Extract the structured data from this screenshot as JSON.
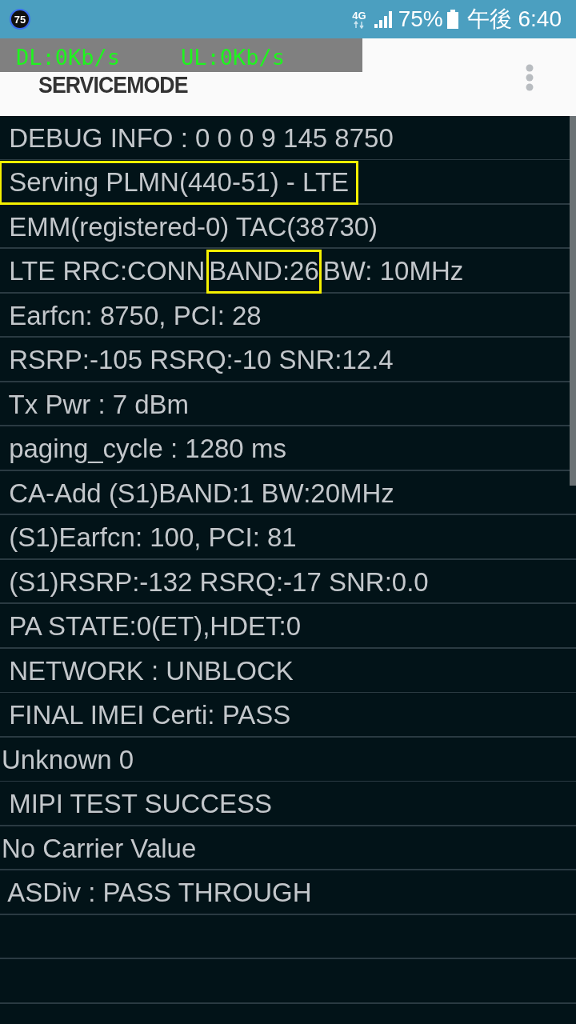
{
  "status_bar": {
    "badge": "75",
    "network": "4G",
    "battery": "75%",
    "time": "午後 6:40"
  },
  "speed_overlay": {
    "download": "DL:0Kb/s",
    "upload": "UL:0Kb/s"
  },
  "app_bar": {
    "title": "SERVICEMODE"
  },
  "rows": [
    {
      "segments": [
        {
          "text": " DEBUG INFO : 0 0 0 9 145 8750",
          "highlighted": false
        }
      ]
    },
    {
      "segments": [
        {
          "text": " Serving PLMN(440-51) - LTE ",
          "highlighted": true
        }
      ]
    },
    {
      "segments": [
        {
          "text": " EMM(registered-0) TAC(38730)",
          "highlighted": false
        }
      ]
    },
    {
      "segments": [
        {
          "text": " LTE RRC:CONN",
          "highlighted": false
        },
        {
          "text": "BAND:26",
          "highlighted": true
        },
        {
          "text": "BW: 10MHz",
          "highlighted": false
        }
      ]
    },
    {
      "segments": [
        {
          "text": " Earfcn: 8750, PCI: 28",
          "highlighted": false
        }
      ]
    },
    {
      "segments": [
        {
          "text": " RSRP:-105 RSRQ:-10 SNR:12.4",
          "highlighted": false
        }
      ]
    },
    {
      "segments": [
        {
          "text": " Tx Pwr : 7 dBm",
          "highlighted": false
        }
      ]
    },
    {
      "segments": [
        {
          "text": " paging_cycle : 1280 ms",
          "highlighted": false
        }
      ]
    },
    {
      "segments": [
        {
          "text": " CA-Add (S1)BAND:1 BW:20MHz",
          "highlighted": false
        }
      ]
    },
    {
      "segments": [
        {
          "text": " (S1)Earfcn: 100, PCI: 81",
          "highlighted": false
        }
      ]
    },
    {
      "segments": [
        {
          "text": " (S1)RSRP:-132 RSRQ:-17 SNR:0.0",
          "highlighted": false
        }
      ]
    },
    {
      "segments": [
        {
          "text": " PA STATE:0(ET),HDET:0",
          "highlighted": false
        }
      ]
    },
    {
      "segments": [
        {
          "text": " NETWORK : UNBLOCK",
          "highlighted": false
        }
      ]
    },
    {
      "segments": [
        {
          "text": " FINAL IMEI Certi: PASS",
          "highlighted": false
        }
      ]
    },
    {
      "segments": [
        {
          "text": "Unknown 0",
          "highlighted": false
        }
      ]
    },
    {
      "segments": [
        {
          "text": " MIPI TEST SUCCESS",
          "highlighted": false
        }
      ]
    },
    {
      "segments": [
        {
          "text": "No Carrier Value",
          "highlighted": false
        }
      ]
    },
    {
      "segments": [
        {
          "text": " ASDiv : PASS THROUGH",
          "highlighted": false
        }
      ]
    }
  ]
}
